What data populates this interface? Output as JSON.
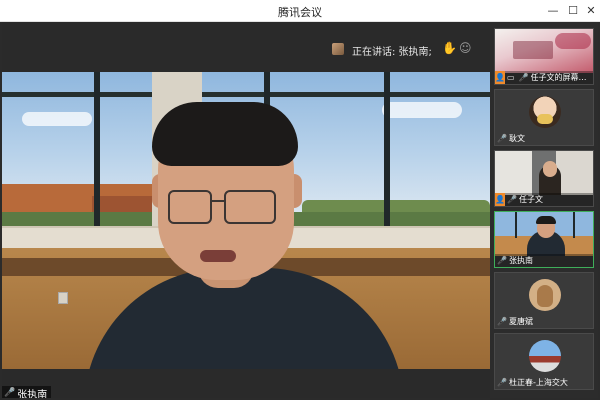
{
  "window": {
    "title": "腾讯会议",
    "minimize_glyph": "—",
    "maximize_glyph": "☐",
    "close_glyph": "✕"
  },
  "main": {
    "speaking_label": "正在讲话: 张执南;",
    "speaker_name": "张执南",
    "reaction_icons": "✋☺"
  },
  "participants": [
    {
      "name": "任子文的屏幕共享",
      "host_icon": "host-icon",
      "video": "screen-share",
      "mic": "on"
    },
    {
      "name": "耿文",
      "host_icon": "",
      "video": "avatar-child",
      "mic": "on"
    },
    {
      "name": "任子文",
      "host_icon": "host-icon",
      "video": "camera",
      "mic": "on"
    },
    {
      "name": "张执南",
      "host_icon": "",
      "video": "camera",
      "mic": "active",
      "active": true
    },
    {
      "name": "夏唐斌",
      "host_icon": "",
      "video": "avatar-cat",
      "mic": "on"
    },
    {
      "name": "杜正春-上海交大",
      "host_icon": "",
      "video": "avatar-gate",
      "mic": "on"
    }
  ],
  "icons": {
    "mic": "🎤",
    "screen": "▭",
    "host": "👤"
  },
  "colors": {
    "active_border": "#3fae5a",
    "mic_active": "#2fd06a",
    "host_badge": "#f08a2a"
  }
}
